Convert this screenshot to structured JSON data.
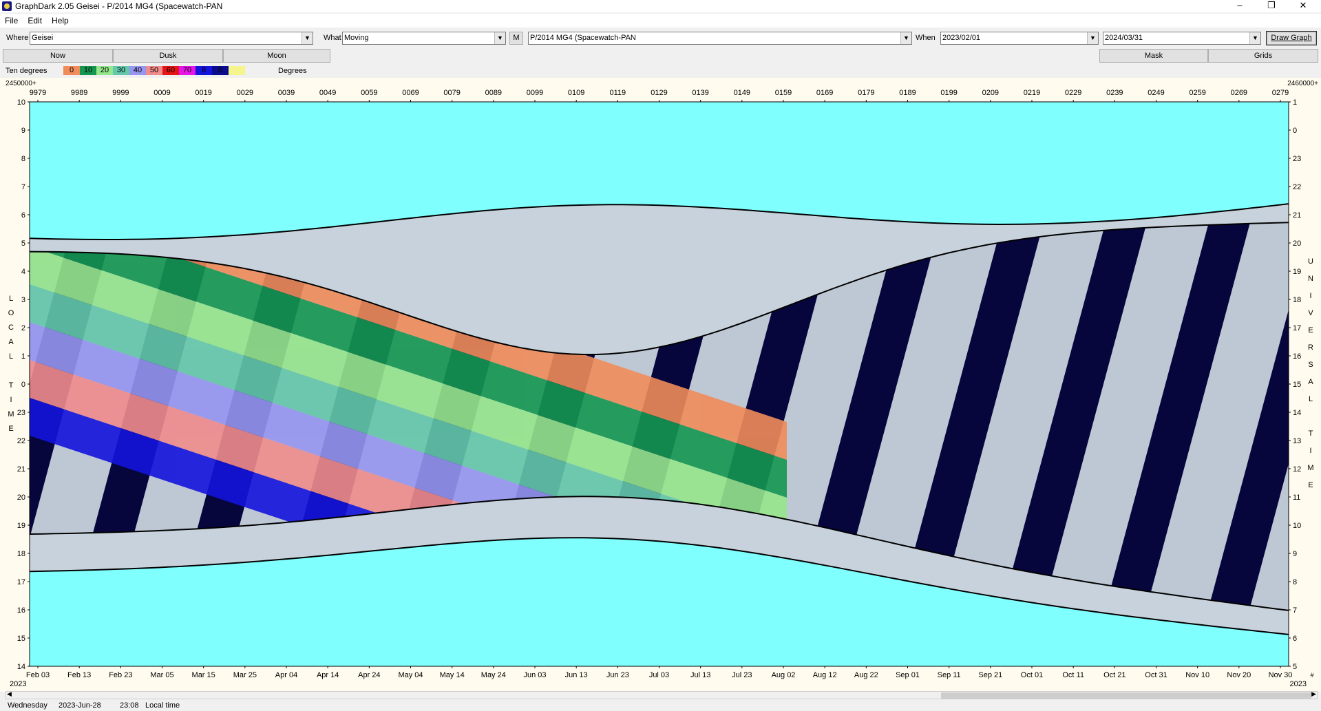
{
  "window": {
    "title": "GraphDark 2.05  Geisei  -  P/2014 MG4 (Spacewatch-PAN",
    "minimize": "–",
    "restore": "❐",
    "close": "✕"
  },
  "menu": [
    "File",
    "Edit",
    "Help"
  ],
  "toolbar": {
    "where_label": "Where",
    "where_value": "Geisei",
    "what_label": "What",
    "what_value": "Moving",
    "m_button": "M",
    "object_value": "P/2014 MG4 (Spacewatch-PAN",
    "when_label": "When",
    "start_date": "2023/02/01",
    "end_date": "2024/03/31",
    "draw_button": "Draw Graph"
  },
  "row2": {
    "now": "Now",
    "dusk": "Dusk",
    "moon": "Moon",
    "mask": "Mask",
    "grids": "Grids"
  },
  "legend": {
    "left_label": "Ten degrees",
    "right_label": "Degrees",
    "items": [
      {
        "label": "0",
        "color": "#f08c5a"
      },
      {
        "label": "10",
        "color": "#149650"
      },
      {
        "label": "20",
        "color": "#96e68c"
      },
      {
        "label": "30",
        "color": "#64c8aa"
      },
      {
        "label": "40",
        "color": "#9696f0"
      },
      {
        "label": "50",
        "color": "#f08c8c"
      },
      {
        "label": "60",
        "color": "#e61414"
      },
      {
        "label": "70",
        "color": "#e614e6"
      },
      {
        "label": "8",
        "color": "#1414dc"
      },
      {
        "label": "0",
        "color": "#0a0a8c"
      },
      {
        "label": "",
        "color": "#f5f58c"
      }
    ]
  },
  "graph": {
    "jd_prefix_left": "2450000+",
    "jd_prefix_right": "2460000+",
    "jd_labels": [
      "9979",
      "9989",
      "9999",
      "0009",
      "0019",
      "0029",
      "0039",
      "0049",
      "0059",
      "0069",
      "0079",
      "0089",
      "0099",
      "0109",
      "0119",
      "0129",
      "0139",
      "0149",
      "0159",
      "0169",
      "0179",
      "0189",
      "0199",
      "0209",
      "0219",
      "0229",
      "0239",
      "0249",
      "0259",
      "0269",
      "0279"
    ],
    "date_labels": [
      "Feb 03",
      "Feb 13",
      "Feb 23",
      "Mar 05",
      "Mar 15",
      "Mar 25",
      "Apr 04",
      "Apr 14",
      "Apr 24",
      "May 04",
      "May 14",
      "May 24",
      "Jun 03",
      "Jun 13",
      "Jun 23",
      "Jul 03",
      "Jul 13",
      "Jul 23",
      "Aug 02",
      "Aug 12",
      "Aug 22",
      "Sep 01",
      "Sep 11",
      "Sep 21",
      "Oct 01",
      "Oct 11",
      "Oct 21",
      "Oct 31",
      "Nov 10",
      "Nov 20",
      "Nov 30"
    ],
    "year_left": "2023",
    "year_right": "2023",
    "far_right_label": "#",
    "left_axis_ticks": [
      "10",
      "9",
      "8",
      "7",
      "6",
      "5",
      "4",
      "3",
      "2",
      "1",
      "0",
      "23",
      "22",
      "21",
      "20",
      "19",
      "18",
      "17",
      "16",
      "15",
      "14"
    ],
    "right_axis_ticks": [
      "1",
      "0",
      "23",
      "22",
      "21",
      "20",
      "19",
      "18",
      "17",
      "16",
      "15",
      "14",
      "13",
      "12",
      "11",
      "10",
      "9",
      "8",
      "7",
      "6",
      "5"
    ],
    "left_axis_title": [
      "L",
      "O",
      "C",
      "A",
      "L",
      "",
      "T",
      "I",
      "M",
      "E"
    ],
    "right_axis_title": [
      "U",
      "N",
      "I",
      "V",
      "E",
      "R",
      "S",
      "A",
      "L",
      "",
      "T",
      "I",
      "M",
      "E"
    ],
    "colors": {
      "day": "#80ffff",
      "night": "#06063c",
      "twilight": "#0a82c8",
      "moon": "#c8d2dc",
      "curve": "#000000"
    }
  },
  "status": {
    "day": "Wednesday",
    "date": "2023-Jun-28",
    "time": "23:08",
    "mode": "Local time"
  }
}
